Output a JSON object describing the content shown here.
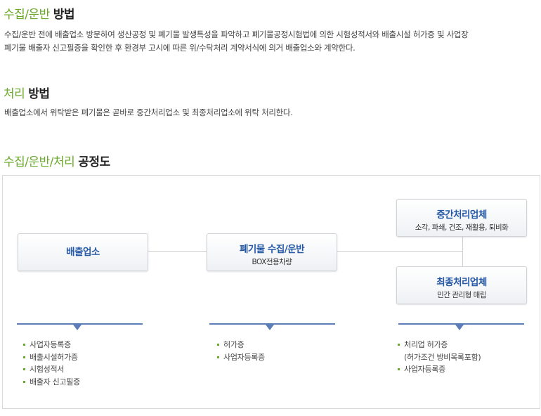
{
  "section1": {
    "title_accent": "수집/운반",
    "title_rest": "방법",
    "text_line1": "수집/운반 전에 배출업소 방문하여 생산공정 및 폐기물 발생특성을 파악하고 폐기물공정시험법에 의한 시험성적서와 배출시설 허가증 및 사업장",
    "text_line2": "폐기물 배출자 신고필증을 확인한 후 환경부 고시에 따른 위/수탁처리 계약서식에 의거 배출업소와 계약한다."
  },
  "section2": {
    "title_accent": "처리",
    "title_rest": "방법",
    "text": "배출업소에서 위탁받은 폐기물은 곧바로 중간처리업소 및 최종처리업소에 위탁 처리한다."
  },
  "section3": {
    "title_accent": "수집/운반/처리",
    "title_rest": "공정도"
  },
  "diagram": {
    "boxes": {
      "emitter": {
        "title": "배출업소"
      },
      "collect": {
        "title": "폐기물 수집/운반",
        "sub": "BOX전용차량"
      },
      "middle": {
        "title": "중간처리업체",
        "sub": "소각, 파쇄, 건조, 재활용, 퇴비화"
      },
      "final": {
        "title": "최종처리업체",
        "sub": "민간 관리형 매립"
      }
    },
    "lists": {
      "emitter": [
        "사업자등록증",
        "배출시설허가증",
        "시험성적서",
        "배출자 신고필증"
      ],
      "collect": [
        "허가증",
        "사업자등록증"
      ],
      "processor": [
        {
          "text": "처리업 허가증",
          "bullet": true
        },
        {
          "text": "(허가조건 방비목록포함)",
          "bullet": false
        },
        {
          "text": "사업자등록증",
          "bullet": true
        }
      ]
    }
  },
  "colors": {
    "accent_green": "#6aa92a",
    "box_title_blue": "#2558a6",
    "connector_blue": "#5d7db8"
  }
}
